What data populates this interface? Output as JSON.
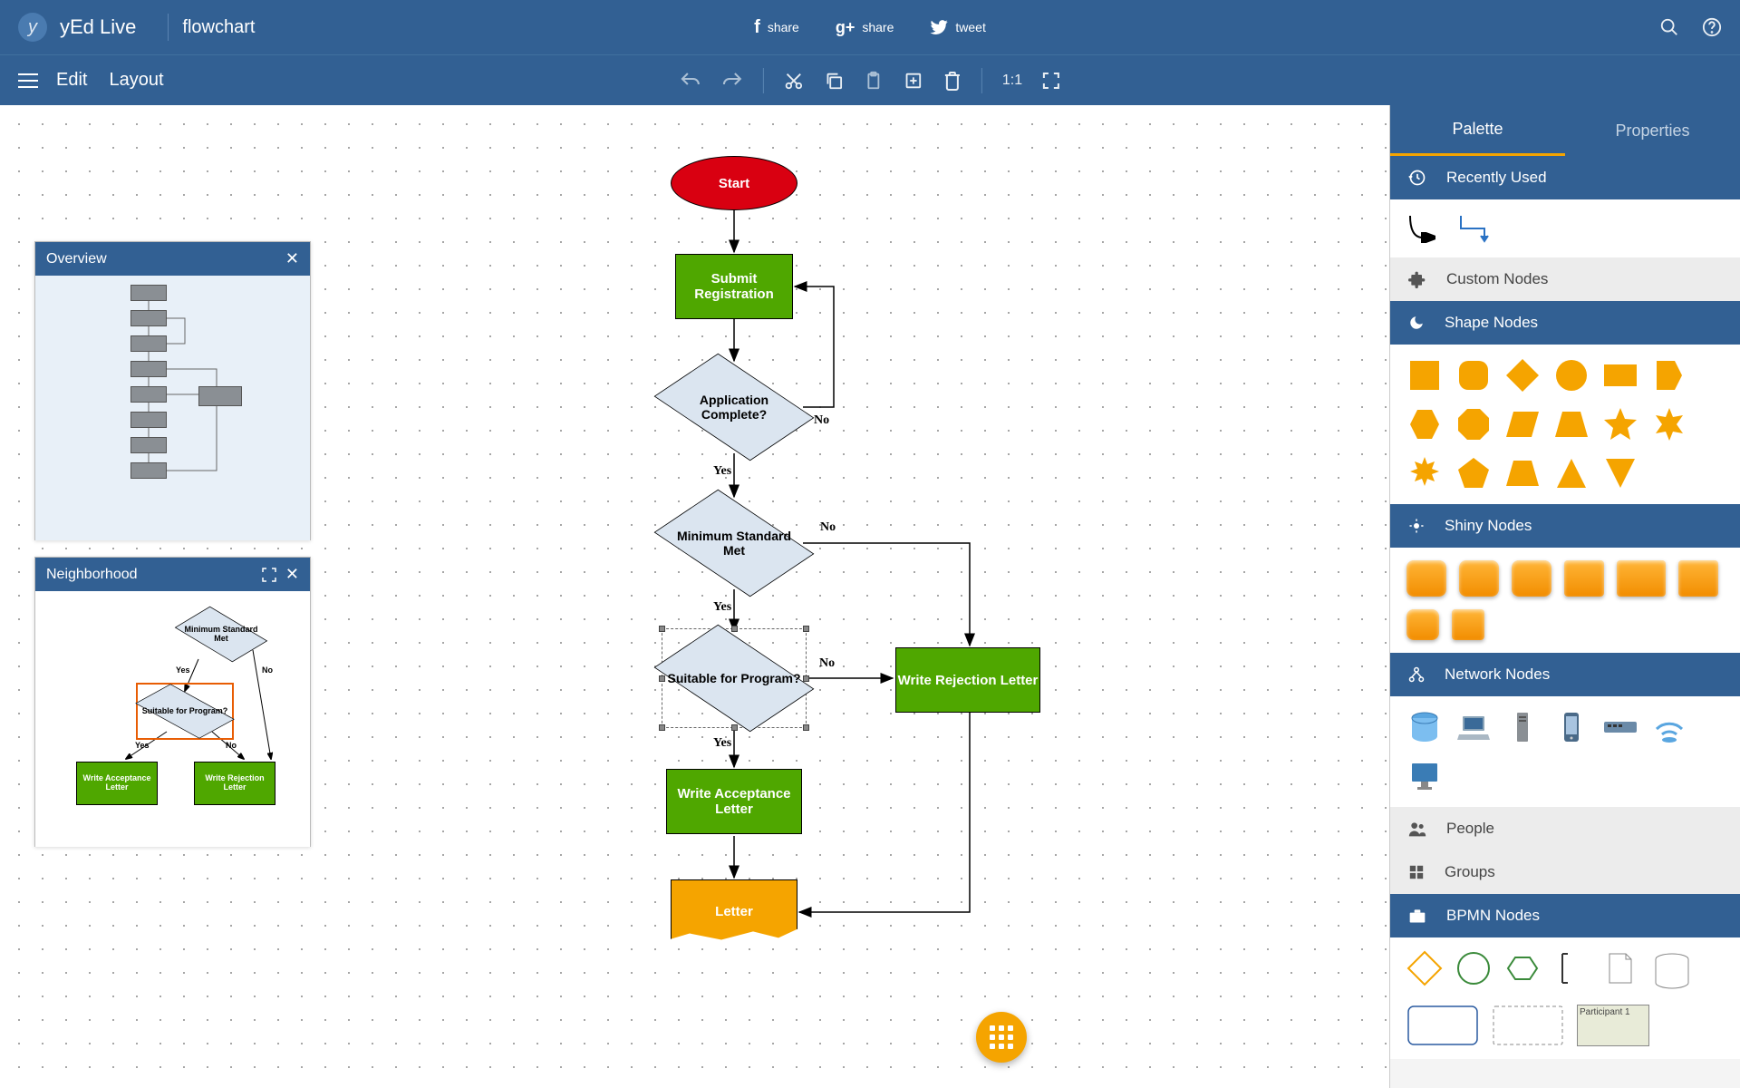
{
  "header": {
    "app_name": "yEd Live",
    "doc_name": "flowchart",
    "share": {
      "fb": "share",
      "gplus": "share",
      "tw": "tweet"
    }
  },
  "menu": {
    "edit": "Edit",
    "layout": "Layout",
    "ratio": "1:1"
  },
  "panels": {
    "overview": {
      "title": "Overview"
    },
    "neighborhood": {
      "title": "Neighborhood",
      "nodes": {
        "top": "Minimum Standard Met",
        "mid": "Suitable for Program?",
        "bl": "Write Acceptance Letter",
        "br": "Write Rejection Letter"
      },
      "edges": {
        "yes": "Yes",
        "no": "No"
      }
    }
  },
  "flow": {
    "start": "Start",
    "submit": "Submit Registration",
    "complete": "Application Complete?",
    "standard": "Minimum Standard Met",
    "suitable": "Suitable for Program?",
    "accept": "Write Acceptance Letter",
    "reject": "Write Rejection Letter",
    "letter": "Letter",
    "yes": "Yes",
    "no": "No"
  },
  "sidebar": {
    "tabs": {
      "palette": "Palette",
      "properties": "Properties"
    },
    "sections": {
      "recent": "Recently Used",
      "custom": "Custom Nodes",
      "shapes": "Shape Nodes",
      "shiny": "Shiny Nodes",
      "network": "Network Nodes",
      "people": "People",
      "groups": "Groups",
      "bpmn": "BPMN Nodes"
    },
    "bpmn_participant": "Participant 1"
  }
}
